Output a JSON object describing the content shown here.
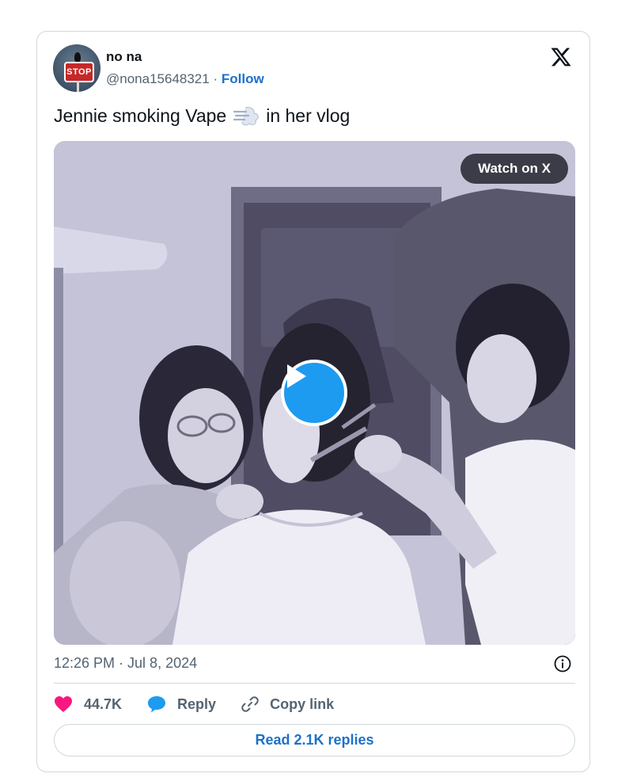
{
  "author": {
    "display_name": "no na",
    "handle": "@nona15648321",
    "separator": "·",
    "follow_label": "Follow",
    "avatar_sign_text": "STOP"
  },
  "tweet": {
    "text_before": "Jennie smoking Vape",
    "emoji": "dashing-away-icon",
    "text_after": "in her vlog"
  },
  "media": {
    "watch_label": "Watch on X",
    "play_icon": "play-icon"
  },
  "meta": {
    "timestamp": "12:26 PM · Jul 8, 2024",
    "info_icon": "info-icon"
  },
  "actions": {
    "likes_count": "44.7K",
    "reply_label": "Reply",
    "copy_link_label": "Copy link",
    "read_replies_label": "Read 2.1K replies"
  },
  "colors": {
    "accent": "#1d9bf0",
    "link": "#1d71c9",
    "heart": "#f91880",
    "muted": "#536471",
    "border": "#cfd9de"
  }
}
